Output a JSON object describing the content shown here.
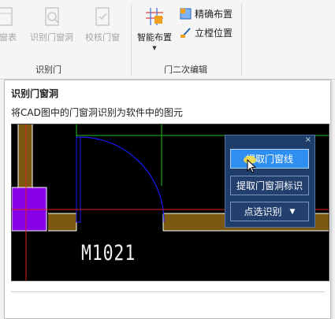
{
  "ribbon": {
    "btn_door_window_table": "门窗表",
    "btn_identify_door_window": "识别门窗洞",
    "btn_verify_door_window": "校核门窗",
    "btn_smart_layout": "智能布置",
    "btn_precise_layout": "精确布置",
    "btn_vertical_position": "立樘位置",
    "group_identify_door": "识别门",
    "group_door_secondary_edit": "门二次编辑"
  },
  "tooltip": {
    "title": "识别门窗洞",
    "description": "将CAD图中的门窗洞识别为软件中的图元",
    "cad_label": "M1021",
    "dialog": {
      "close": "×",
      "btn_extract_door_window_line": "提取门窗线",
      "btn_extract_door_window_tag": "提取门窗洞标识",
      "btn_point_select_identify": "点选识别",
      "dropdown_arrow": "▼"
    }
  },
  "colors": {
    "cad_background": "#000000",
    "wall_fill": "#7a5810",
    "column_fill": "#8a00e6",
    "door_arc": "#1a1aff",
    "axis_red": "#e02020",
    "axis_green": "#20c020",
    "dialog_bg": "#1e3d6b",
    "dialog_highlight": "#2f8ff0"
  }
}
